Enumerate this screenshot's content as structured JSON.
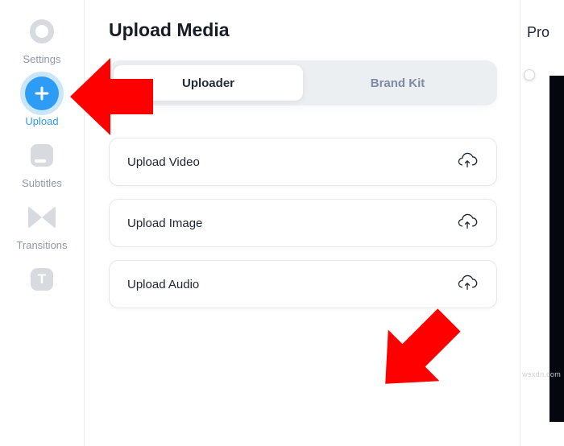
{
  "sidebar": {
    "items": [
      {
        "label": "Settings",
        "name": "sidebar-item-settings"
      },
      {
        "label": "Upload",
        "name": "sidebar-item-upload",
        "active": true
      },
      {
        "label": "Subtitles",
        "name": "sidebar-item-subtitles"
      },
      {
        "label": "Transitions",
        "name": "sidebar-item-transitions"
      },
      {
        "label": "",
        "name": "sidebar-item-text"
      }
    ]
  },
  "panel": {
    "title": "Upload Media",
    "tabs": {
      "uploader": "Uploader",
      "brand_kit": "Brand Kit"
    },
    "rows": {
      "video": "Upload Video",
      "image": "Upload Image",
      "audio": "Upload Audio"
    }
  },
  "right": {
    "label": "Pro"
  },
  "watermark": "wsxdn.com",
  "colors": {
    "accent": "#2d9cf5",
    "text": "#1e2432",
    "muted": "#9099a8",
    "tab_bg": "#eceff2",
    "arrow": "#fe0000"
  }
}
